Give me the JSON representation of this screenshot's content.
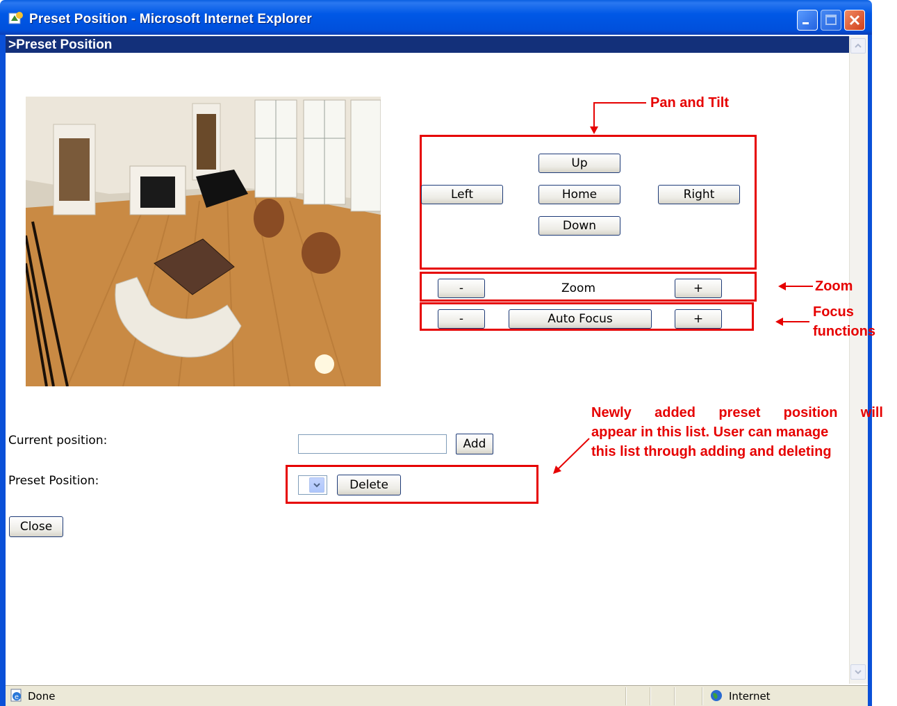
{
  "window": {
    "title": "Preset Position - Microsoft Internet Explorer"
  },
  "page": {
    "header": ">Preset Position"
  },
  "pan_tilt": {
    "up": "Up",
    "left": "Left",
    "home": "Home",
    "right": "Right",
    "down": "Down"
  },
  "zoom": {
    "minus": "-",
    "label": "Zoom",
    "plus": "+"
  },
  "focus": {
    "minus": "-",
    "auto": "Auto Focus",
    "plus": "+"
  },
  "form": {
    "current_label": "Current position:",
    "current_value": "",
    "add_button": "Add",
    "preset_label": "Preset Position:",
    "preset_selected": "",
    "delete_button": "Delete",
    "close_button": "Close"
  },
  "annotations": {
    "pan_tilt": "Pan and Tilt",
    "zoom": "Zoom",
    "focus_line1": "Focus",
    "focus_line2": "functions",
    "list_line1": "Newly added preset position will",
    "list_line2": "appear in this list. User can manage",
    "list_line3": "this list through adding and deleting"
  },
  "statusbar": {
    "status": "Done",
    "zone": "Internet"
  },
  "colors": {
    "annotation_red": "#e60000",
    "title_blue": "#0058e6",
    "header_band": "#13307a"
  }
}
